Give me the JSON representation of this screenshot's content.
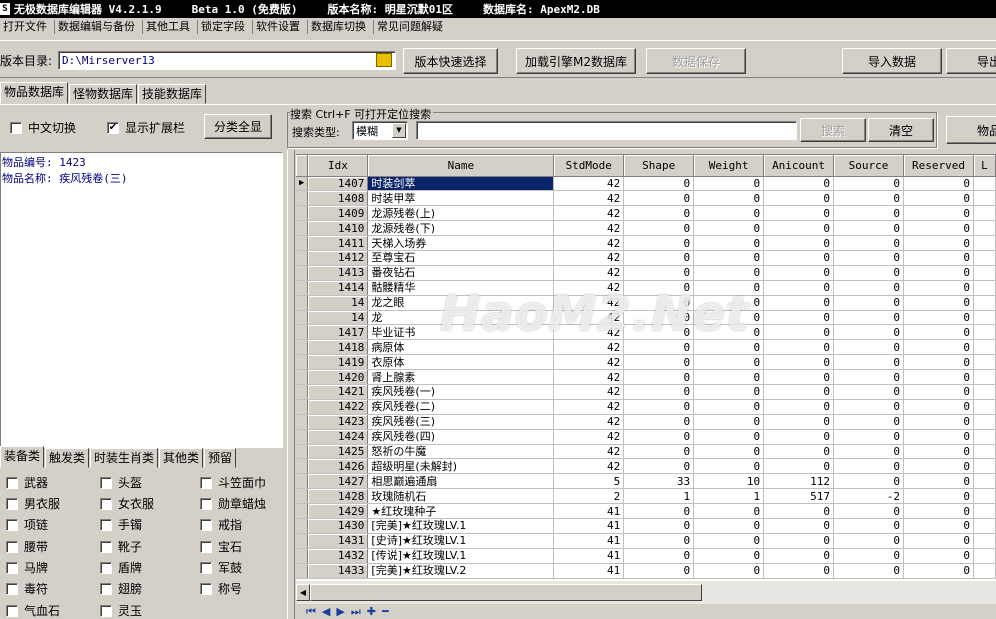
{
  "title": {
    "app_name": "无极数据库编辑器 V4.2.1.9",
    "edition": "Beta 1.0 (免费版)",
    "version_name": "版本名称: 明星沉默01区",
    "db_name": "数据库名: ApexM2.DB"
  },
  "menu": [
    "打开文件",
    "数据编辑与备份",
    "其他工具",
    "锁定字段",
    "软件设置",
    "数据库切换",
    "常见问题解疑"
  ],
  "toolbar": {
    "dir_label": "版本目录:",
    "dir_value": "D:\\Mirserver13",
    "quick_select": "版本快速选择",
    "load_engine": "加载引擎M2数据库",
    "save_data": "数据保存",
    "import_data": "导入数据",
    "export_data": "导出"
  },
  "db_tabs": [
    "物品数据库",
    "怪物数据库",
    "技能数据库"
  ],
  "options": {
    "chinese_toggle": "中文切换",
    "show_ext": "显示扩展栏",
    "show_all_btn": "分类全显"
  },
  "search": {
    "title": "搜索  Ctrl+F 可打开定位搜索",
    "type_label": "搜索类型:",
    "type_value": "模糊",
    "search_btn": "搜索",
    "clear_btn": "清空",
    "item_btn": "物品"
  },
  "info": {
    "item_id": "物品编号: 1423",
    "item_name": "物品名称: 疾风残卷(三)"
  },
  "category_tabs": [
    "装备类",
    "触发类",
    "时装生肖类",
    "其他类",
    "预留"
  ],
  "categories": [
    [
      "武器",
      "头盔",
      "斗笠面巾"
    ],
    [
      "男衣服",
      "女衣服",
      "勋章蜡烛"
    ],
    [
      "项链",
      "手镯",
      "戒指"
    ],
    [
      "腰带",
      "靴子",
      "宝石"
    ],
    [
      "马牌",
      "盾牌",
      "军鼓"
    ],
    [
      "毒符",
      "翅膀",
      "称号"
    ],
    [
      "气血石",
      "灵玉",
      ""
    ]
  ],
  "grid": {
    "columns": [
      "Idx",
      "Name",
      "StdMode",
      "Shape",
      "Weight",
      "Anicount",
      "Source",
      "Reserved",
      "L"
    ],
    "rows": [
      [
        "1407",
        "时装剑萃",
        "42",
        "0",
        "0",
        "0",
        "0",
        "0"
      ],
      [
        "1408",
        "时装甲萃",
        "42",
        "0",
        "0",
        "0",
        "0",
        "0"
      ],
      [
        "1409",
        "龙源残卷(上)",
        "42",
        "0",
        "0",
        "0",
        "0",
        "0"
      ],
      [
        "1410",
        "龙源残卷(下)",
        "42",
        "0",
        "0",
        "0",
        "0",
        "0"
      ],
      [
        "1411",
        "天梯入场券",
        "42",
        "0",
        "0",
        "0",
        "0",
        "0"
      ],
      [
        "1412",
        "至尊宝石",
        "42",
        "0",
        "0",
        "0",
        "0",
        "0"
      ],
      [
        "1413",
        "番夜钻石",
        "42",
        "0",
        "0",
        "0",
        "0",
        "0"
      ],
      [
        "1414",
        "骷髅精华",
        "42",
        "0",
        "0",
        "0",
        "0",
        "0"
      ],
      [
        "14",
        "龙之眼",
        "42",
        "0",
        "0",
        "0",
        "0",
        "0"
      ],
      [
        "14",
        "龙",
        "42",
        "0",
        "0",
        "0",
        "0",
        "0"
      ],
      [
        "1417",
        "毕业证书",
        "42",
        "0",
        "0",
        "0",
        "0",
        "0"
      ],
      [
        "1418",
        "病原体",
        "42",
        "0",
        "0",
        "0",
        "0",
        "0"
      ],
      [
        "1419",
        "衣原体",
        "42",
        "0",
        "0",
        "0",
        "0",
        "0"
      ],
      [
        "1420",
        "肾上腺素",
        "42",
        "0",
        "0",
        "0",
        "0",
        "0"
      ],
      [
        "1421",
        "疾风残卷(一)",
        "42",
        "0",
        "0",
        "0",
        "0",
        "0"
      ],
      [
        "1422",
        "疾风残卷(二)",
        "42",
        "0",
        "0",
        "0",
        "0",
        "0"
      ],
      [
        "1423",
        "疾风残卷(三)",
        "42",
        "0",
        "0",
        "0",
        "0",
        "0"
      ],
      [
        "1424",
        "疾风残卷(四)",
        "42",
        "0",
        "0",
        "0",
        "0",
        "0"
      ],
      [
        "1425",
        "怒祈の牛魔",
        "42",
        "0",
        "0",
        "0",
        "0",
        "0"
      ],
      [
        "1426",
        "超级明星(未解封)",
        "42",
        "0",
        "0",
        "0",
        "0",
        "0"
      ],
      [
        "1427",
        "相思巅遍通扇",
        "5",
        "33",
        "10",
        "112",
        "0",
        "0"
      ],
      [
        "1428",
        "玫瑰随机石",
        "2",
        "1",
        "1",
        "517",
        "-2",
        "0"
      ],
      [
        "1429",
        "★红玫瑰种子",
        "41",
        "0",
        "0",
        "0",
        "0",
        "0"
      ],
      [
        "1430",
        "[完美]★红玫瑰LV.1",
        "41",
        "0",
        "0",
        "0",
        "0",
        "0"
      ],
      [
        "1431",
        "[史诗]★红玫瑰LV.1",
        "41",
        "0",
        "0",
        "0",
        "0",
        "0"
      ],
      [
        "1432",
        "[传说]★红玫瑰LV.1",
        "41",
        "0",
        "0",
        "0",
        "0",
        "0"
      ],
      [
        "1433",
        "[完美]★红玫瑰LV.2",
        "41",
        "0",
        "0",
        "0",
        "0",
        "0"
      ]
    ]
  },
  "watermark": "HaoM2.Net",
  "colors": {
    "selection": "#0a246a",
    "face": "#d4d0c8",
    "info_text": "#000080"
  }
}
